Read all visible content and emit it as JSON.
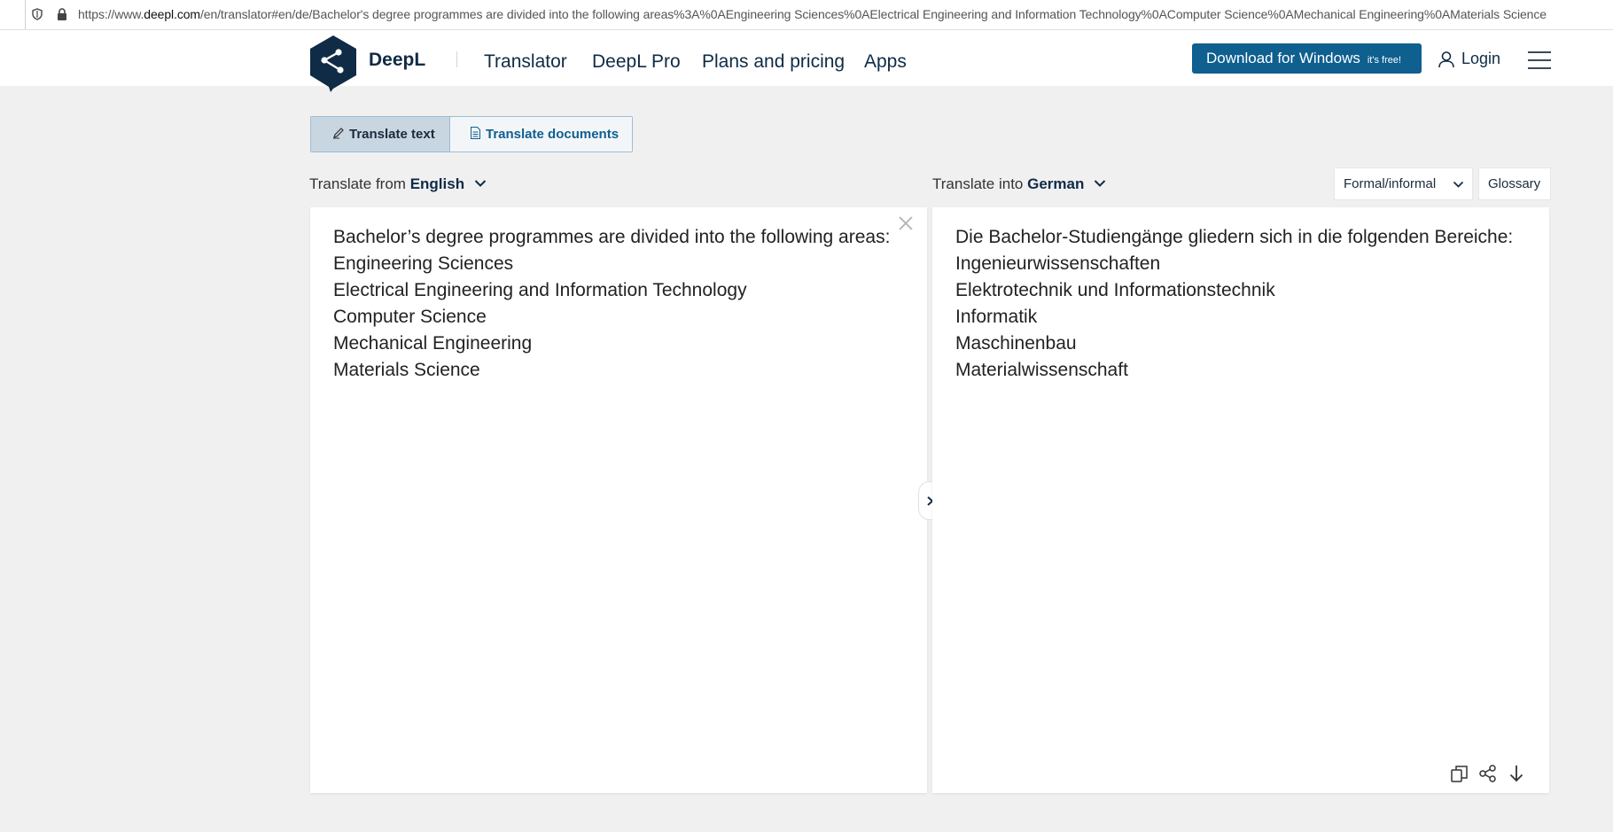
{
  "browser": {
    "url_prefix": "https://www.",
    "url_domain": "deepl.com",
    "url_rest": "/en/translator#en/de/Bachelor's degree programmes are divided into the following areas%3A%0AEngineering Sciences%0AElectrical Engineering and Information Technology%0AComputer Science%0AMechanical Engineering%0AMaterials Science"
  },
  "header": {
    "brand": "DeepL",
    "nav": [
      "Translator",
      "DeepL Pro",
      "Plans and pricing",
      "Apps"
    ],
    "download_label": "Download for Windows",
    "download_badge": "it's free!",
    "login_label": "Login"
  },
  "modes": {
    "text_label": "Translate text",
    "docs_label": "Translate documents"
  },
  "source": {
    "prefix": "Translate from ",
    "language": "English",
    "lines": [
      "Bachelor’s degree programmes are divided into the following areas:",
      "Engineering Sciences",
      "Electrical Engineering and Information Technology",
      "Computer Science",
      "Mechanical Engineering",
      "Materials Science"
    ]
  },
  "target": {
    "prefix": "Translate into ",
    "language": "German",
    "formality_label": "Formal/informal",
    "glossary_label": "Glossary",
    "lines": [
      "Die Bachelor-Studiengänge gliedern sich in die folgenden Bereiche:",
      "Ingenieurwissenschaften",
      "Elektrotechnik und Informationstechnik",
      "Informatik",
      "Maschinenbau",
      "Materialwissenschaft"
    ]
  },
  "colors": {
    "brand_navy": "#0f2b46",
    "download_blue": "#0f5f8f",
    "page_bg": "#f0f0f0"
  }
}
